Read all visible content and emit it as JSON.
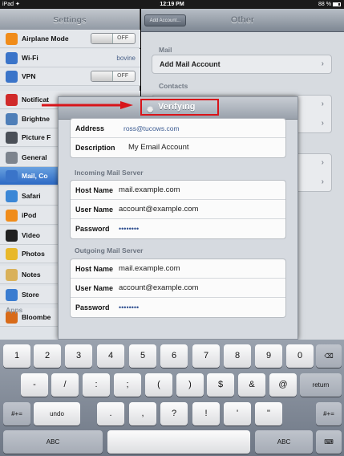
{
  "status_bar": {
    "carrier": "iPad ✦",
    "time": "12:19 PM",
    "battery": "88 %"
  },
  "settings": {
    "title": "Settings",
    "items": [
      {
        "label": "Airplane Mode",
        "toggle": "OFF",
        "icon": "airplane-icon",
        "color": "#f08c1a"
      },
      {
        "label": "Wi-Fi",
        "value": "bovine",
        "icon": "wifi-icon",
        "color": "#3a74c9"
      },
      {
        "label": "VPN",
        "toggle": "OFF",
        "icon": "vpn-icon",
        "color": "#3a74c9"
      },
      {
        "label": "Notificat",
        "icon": "notifications-icon",
        "color": "#d02a2a"
      },
      {
        "label": "Brightne",
        "icon": "brightness-icon",
        "color": "#4f7fb8"
      },
      {
        "label": "Picture F",
        "icon": "picture-frame-icon",
        "color": "#4a4f57"
      },
      {
        "label": "General",
        "icon": "gear-icon",
        "color": "#7d848d"
      },
      {
        "label": "Mail, Co",
        "icon": "mail-icon",
        "color": "#3a74c9"
      },
      {
        "label": "Safari",
        "icon": "safari-icon",
        "color": "#3b87d6"
      },
      {
        "label": "iPod",
        "icon": "ipod-icon",
        "color": "#f08c1a"
      },
      {
        "label": "Video",
        "icon": "video-icon",
        "color": "#202020"
      },
      {
        "label": "Photos",
        "icon": "photos-icon",
        "color": "#e8b82a"
      },
      {
        "label": "Notes",
        "icon": "notes-icon",
        "color": "#d9b15a"
      },
      {
        "label": "Store",
        "icon": "store-icon",
        "color": "#3a7cd0"
      },
      {
        "label": "Bloombe",
        "icon": "bloomberg-icon",
        "color": "#d86b1a"
      }
    ],
    "apps_header": "Apps"
  },
  "detail": {
    "back": "Add Account...",
    "title": "Other",
    "sections": {
      "mail": "Mail",
      "contacts": "Contacts"
    },
    "add_mail": "Add Mail Account"
  },
  "modal": {
    "verifying": "Verifying",
    "account": [
      {
        "label": "Address",
        "value": "ross@tucows.com"
      },
      {
        "label": "Description",
        "value": "My Email Account"
      }
    ],
    "incoming_header": "Incoming Mail Server",
    "incoming": [
      {
        "label": "Host Name",
        "value": "mail.example.com"
      },
      {
        "label": "User Name",
        "value": "account@example.com"
      },
      {
        "label": "Password",
        "value": "••••••••"
      }
    ],
    "outgoing_header": "Outgoing Mail Server",
    "outgoing": [
      {
        "label": "Host Name",
        "value": "mail.example.com"
      },
      {
        "label": "User Name",
        "value": "account@example.com"
      },
      {
        "label": "Password",
        "value": "••••••••"
      }
    ]
  },
  "keyboard": {
    "row1": [
      "1",
      "2",
      "3",
      "4",
      "5",
      "6",
      "7",
      "8",
      "9",
      "0",
      "⌫"
    ],
    "row2": [
      "-",
      "/",
      ":",
      ";",
      "(",
      ")",
      "$",
      "&",
      "@",
      "return"
    ],
    "row3": [
      "#+=",
      "undo",
      ".",
      ",",
      "?",
      "!",
      "'",
      "\"",
      "#+="
    ],
    "row4": [
      "ABC",
      "",
      "ABC",
      "⌨"
    ]
  },
  "colors": {
    "highlight": "#d8141a",
    "selected": "#2b68c4"
  }
}
